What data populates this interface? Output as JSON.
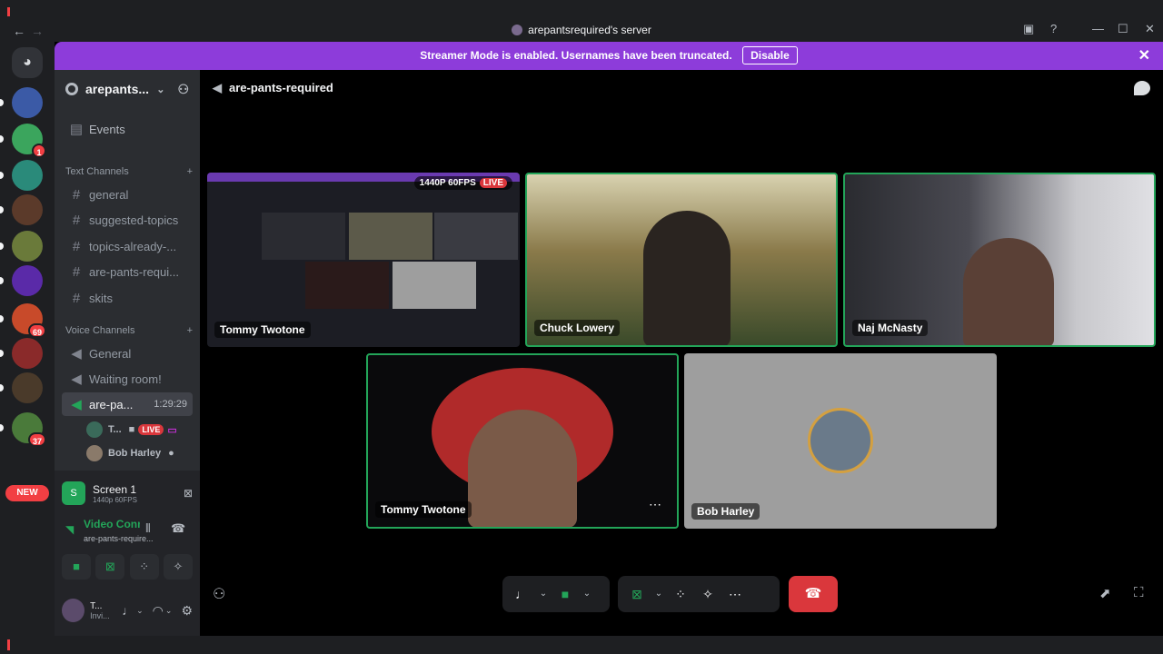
{
  "window": {
    "title": "arepantsrequired's server",
    "back": "←",
    "forward": "→"
  },
  "banner": {
    "text": "Streamer Mode is enabled. Usernames have been truncated.",
    "button": "Disable"
  },
  "servers": [
    {
      "color": "#3b5aa6",
      "badge": ""
    },
    {
      "color": "#3ba55d",
      "badge": "1"
    },
    {
      "color": "#2a8a7a",
      "badge": ""
    },
    {
      "color": "#5b3a2a",
      "badge": ""
    },
    {
      "color": "#6a7a3a",
      "badge": ""
    },
    {
      "color": "#5a2aa8",
      "badge": ""
    },
    {
      "color": "#c84a2a",
      "badge": "69"
    },
    {
      "color": "#8a2a2a",
      "badge": ""
    },
    {
      "color": "#4a3a2a",
      "badge": ""
    },
    {
      "color": "#4a7a3a",
      "badge": "37"
    }
  ],
  "new_badge": "NEW",
  "server": {
    "name": "arepants..."
  },
  "events": "Events",
  "text_channels": {
    "header": "Text Channels",
    "items": [
      "general",
      "suggested-topics",
      "topics-already-...",
      "are-pants-requi...",
      "skits"
    ]
  },
  "voice_channels": {
    "header": "Voice Channels",
    "items": [
      "General",
      "Waiting room!"
    ],
    "active": {
      "name": "are-pa...",
      "timer": "1:29:29"
    },
    "members": [
      {
        "name": "T...",
        "live": "LIVE",
        "color": "#3a6a5a"
      },
      {
        "name": "Bob Harley",
        "color": "#8a7a6a"
      }
    ]
  },
  "panel": {
    "screen_title": "Screen 1",
    "screen_sub": "1440p 60FPS",
    "screen_icon": "S",
    "vc_title": "Video Connected",
    "vc_channel": "are-pants-require...",
    "user_short": "T...",
    "user_status": "Invi..."
  },
  "stage": {
    "channel": "are-pants-required",
    "tiles": [
      {
        "name": "Tommy Twotone",
        "quality": "1440P 60FPS",
        "live": "LIVE",
        "bg": "#1c1d24",
        "speaking": false
      },
      {
        "name": "Chuck Lowery",
        "bg": "#5c5a4a",
        "speaking": true
      },
      {
        "name": "Naj McNasty",
        "bg": "#3a3b42",
        "speaking": true
      },
      {
        "name": "Tommy Twotone",
        "bg": "#1a1616",
        "speaking": true
      },
      {
        "name": "Bob Harley",
        "bg": "#9e9e9e",
        "speaking": false
      }
    ]
  },
  "colors": {
    "green": "#23a559",
    "red": "#da373c",
    "banner": "#8d3cda"
  }
}
